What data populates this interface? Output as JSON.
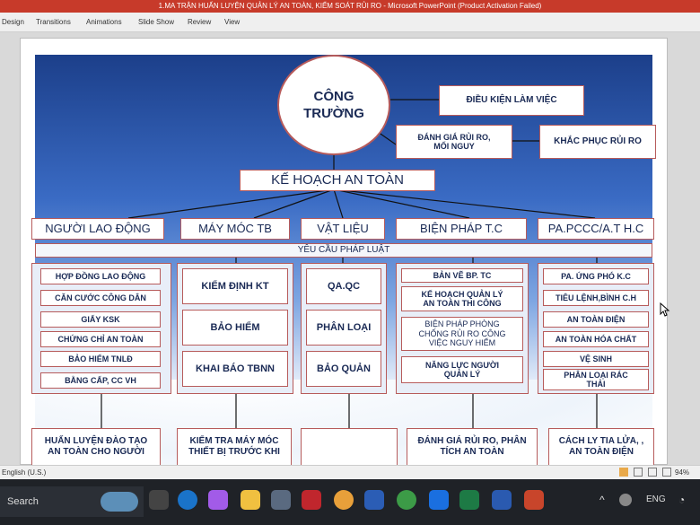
{
  "window": {
    "title": "1.MA TRẬN HUẤN LUYỆN QUẢN LÝ AN TOÀN, KIỂM SOÁT RỦI RO - Microsoft PowerPoint (Product Activation Failed)"
  },
  "ribbon": {
    "tabs": [
      "Design",
      "Transitions",
      "Animations",
      "Slide Show",
      "Review",
      "View"
    ]
  },
  "diagram": {
    "root": "CÔNG\nTRƯỜNG",
    "working_conditions": "ĐIỀU KIỆN LÀM VIỆC",
    "risk_assessment": "ĐÁNH GIÁ RỦI RO,\nMỐI NGUY",
    "risk_remedy": "KHẮC PHỤC RỦI RO",
    "safety_plan": "KẾ HOẠCH AN TOÀN",
    "legal_requirements": "YÊU CẦU PHÁP LUẬT",
    "categories": [
      {
        "label": "NGƯỜI LAO ĐỘNG",
        "items": [
          "HỢP ĐỒNG LAO ĐỘNG",
          "CĂN CƯỚC CÔNG DÂN",
          "GIẤY KSK",
          "CHỨNG CHỈ AN TOÀN",
          "BẢO HIỂM TNLĐ",
          "BẰNG CẤP, CC VH"
        ],
        "bottom": "HUẤN LUYỆN ĐÀO TẠO\nAN TOÀN CHO NGƯỜI"
      },
      {
        "label": "MÁY MÓC TB",
        "items": [
          "KIỂM ĐỊNH KT",
          "BẢO HIỂM",
          "KHAI BÁO TBNN"
        ],
        "bottom": "KIỂM TRA MÁY MÓC\nTHIẾT BỊ TRƯỚC KHI"
      },
      {
        "label": "VẬT LIỆU",
        "items": [
          "QA.QC",
          "PHÂN LOẠI",
          "BẢO QUẢN"
        ],
        "bottom": ""
      },
      {
        "label": "BIỆN PHÁP T.C",
        "items": [
          "BẢN VẼ BP. TC",
          "KẾ HOẠCH QUẢN LÝ\nAN TOÀN THI CÔNG",
          "BIỆN PHÁP PHÒNG\nCHỐNG RỦI RO CÔNG\nVIỆC NGUY HIỂM",
          "NĂNG LỰC NGƯỜI\nQUẢN LÝ"
        ],
        "bottom": "ĐÁNH GIÁ RỦI RO, PHÂN\nTÍCH AN TOÀN"
      },
      {
        "label": "PA.PCCC/A.T H.C",
        "items": [
          "PA. ỨNG PHÓ K.C",
          "TIÊU LỆNH,BÌNH C.H",
          "AN TOÀN ĐIỆN",
          "AN TOÀN HÓA CHẤT",
          "VỆ SINH",
          "PHÂN LOẠI RÁC\nTHẢI"
        ],
        "bottom": "CÁCH LY TIA LỬA, ,\nAN TOÀN ĐIỆN"
      }
    ]
  },
  "statusbar": {
    "language": "English (U.S.)",
    "zoom": "94%"
  },
  "taskbar": {
    "search": "Search",
    "lang": "ENG"
  },
  "colors": {
    "accent": "#c73a2a",
    "border": "#b75b5b",
    "text": "#1a2a55"
  }
}
